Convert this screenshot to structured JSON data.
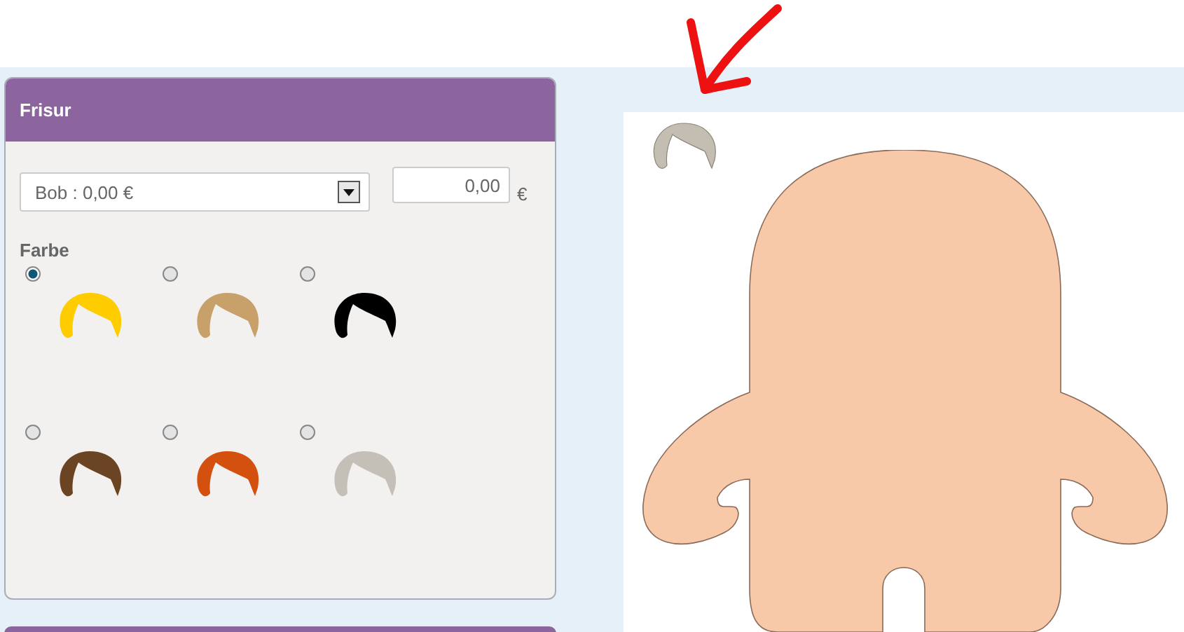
{
  "panel": {
    "title": "Frisur",
    "style_select": {
      "value": "Bob : 0,00 €"
    },
    "price_field": {
      "value": "0,00"
    },
    "currency": "€",
    "color_label": "Farbe",
    "colors": [
      {
        "color": "#ffcc00",
        "selected": true
      },
      {
        "color": "#c8a06a",
        "selected": false
      },
      {
        "color": "#000000",
        "selected": false
      },
      {
        "color": "#6b4423",
        "selected": false
      },
      {
        "color": "#d4500f",
        "selected": false
      },
      {
        "color": "#c4c0b8",
        "selected": false
      }
    ]
  }
}
